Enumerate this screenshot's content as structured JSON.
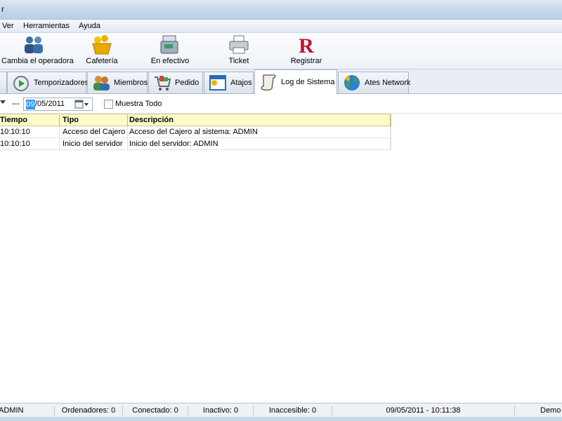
{
  "window": {
    "title_fragment": "r"
  },
  "menu": [
    "Ver",
    "Herramientas",
    "Ayuda"
  ],
  "toolbar": [
    {
      "label": "Cambia el operadora",
      "icon": "users-icon"
    },
    {
      "label": "Cafetería",
      "icon": "basket-icon"
    },
    {
      "label": "En efectivo",
      "icon": "cash-register-icon"
    },
    {
      "label": "Ticket",
      "icon": "printer-icon"
    },
    {
      "label": "Registrar",
      "icon": "registrar-r-icon"
    }
  ],
  "tabs": [
    {
      "label": "Temporizadores",
      "icon": "stopwatch-icon"
    },
    {
      "label": "Miembros",
      "icon": "members-icon"
    },
    {
      "label": "Pedido",
      "icon": "cart-icon"
    },
    {
      "label": "Atajos",
      "icon": "shortcut-window-icon"
    },
    {
      "label": "Log de Sistema",
      "icon": "scroll-icon",
      "active": true
    },
    {
      "label": "Ates Network",
      "icon": "globe-icon"
    }
  ],
  "filter": {
    "separator": "---",
    "date_selected": "09",
    "date_rest": "/05/2011",
    "show_all_label": "Muestra Todo"
  },
  "log": {
    "columns": [
      "Tiempo",
      "Tipo",
      "Descripción"
    ],
    "rows": [
      [
        "10:10:10",
        "Acceso del Cajero al sistema",
        "Acceso del Cajero al sistema: ADMIN"
      ],
      [
        "10:10:10",
        "Inicio del servidor",
        "Inicio del servidor: ADMIN"
      ]
    ]
  },
  "status": {
    "user": "ADMIN",
    "ordenadores": "Ordenadores: 0",
    "conectado": "Conectado: 0",
    "inactivo": "Inactivo: 0",
    "inaccesible": "Inaccesible: 0",
    "datetime": "09/05/2011 - 10:11:38",
    "mode": "Demo"
  },
  "colors": {
    "header_bg": "#fdfcc8",
    "selection": "#3399ff",
    "accent_red": "#c8102e"
  }
}
